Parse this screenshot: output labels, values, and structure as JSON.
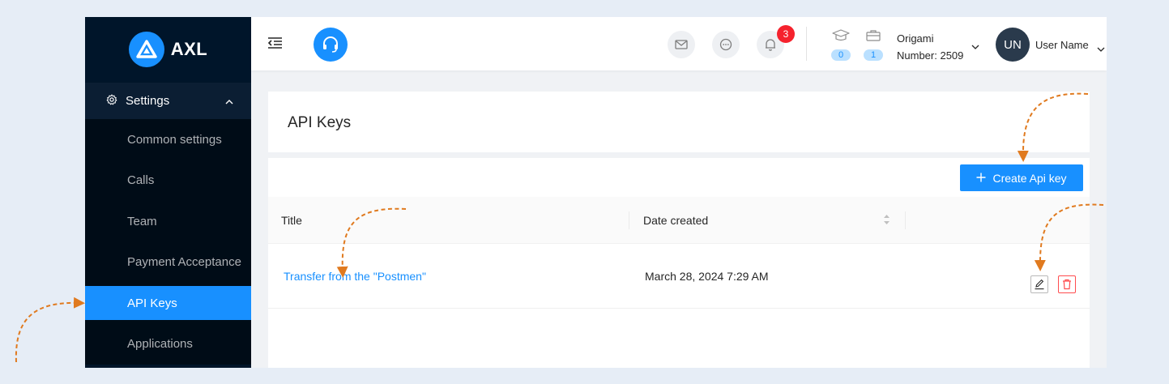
{
  "brand": {
    "name": "AXL"
  },
  "sidebar": {
    "group_label": "Settings",
    "items": [
      {
        "label": "Common settings",
        "active": false
      },
      {
        "label": "Calls",
        "active": false
      },
      {
        "label": "Team",
        "active": false
      },
      {
        "label": "Payment Acceptance",
        "active": false
      },
      {
        "label": "API Keys",
        "active": true
      },
      {
        "label": "Applications",
        "active": false
      }
    ]
  },
  "header": {
    "notifications_count": "3",
    "courses_count": "0",
    "cases_count": "1",
    "company_name": "Origami",
    "company_number": "Number: 2509",
    "avatar_initials": "UN",
    "user_name": "User Name"
  },
  "page": {
    "title": "API Keys",
    "create_button_label": "Create Api key",
    "columns": [
      "Title",
      "Date created"
    ],
    "rows": [
      {
        "title": "Transfer from the \"Postmen\"",
        "date": "March 28, 2024 7:29 AM"
      }
    ]
  },
  "colors": {
    "accent": "#1890ff",
    "sidebar_bg": "#001529",
    "danger": "#ff4d4f",
    "annotation": "#e07a1f"
  }
}
